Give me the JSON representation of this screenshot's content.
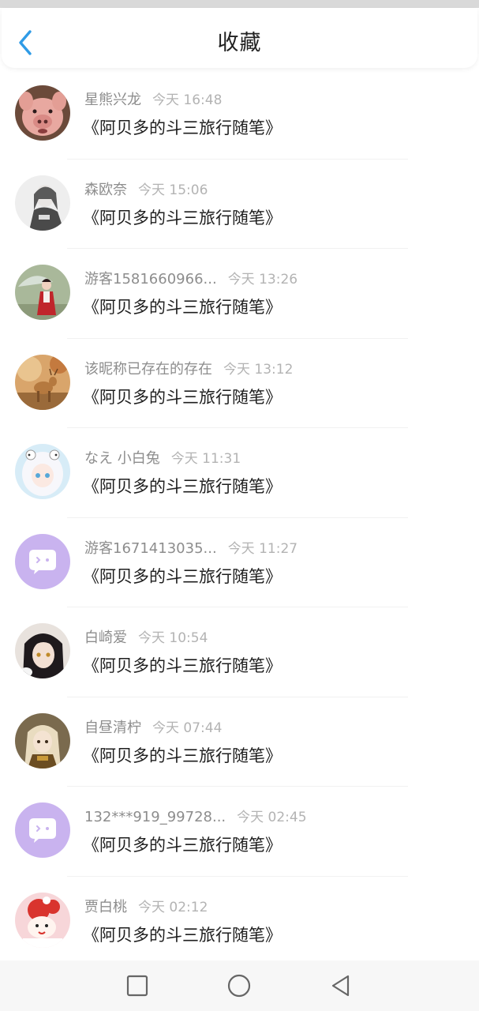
{
  "header": {
    "title": "收藏"
  },
  "items": [
    {
      "name": "星熊兴龙",
      "time": "今天 16:48",
      "book": "《阿贝多的斗三旅行随笔》",
      "avatar_kind": "pig-photo"
    },
    {
      "name": "森欧奈",
      "time": "今天 15:06",
      "book": "《阿贝多的斗三旅行随笔》",
      "avatar_kind": "sketch-girl"
    },
    {
      "name": "游客1581660966...",
      "time": "今天 13:26",
      "book": "《阿贝多的斗三旅行随笔》",
      "avatar_kind": "girl-umbrella"
    },
    {
      "name": "该昵称已存在的存在",
      "time": "今天 13:12",
      "book": "《阿贝多的斗三旅行随笔》",
      "avatar_kind": "deer-autumn"
    },
    {
      "name": "なえ 小白兔",
      "time": "今天 11:31",
      "book": "《阿贝多的斗三旅行随笔》",
      "avatar_kind": "anime-white"
    },
    {
      "name": "游客1671413035...",
      "time": "今天 11:27",
      "book": "《阿贝多的斗三旅行随笔》",
      "avatar_kind": "default-chat"
    },
    {
      "name": "白崎爱",
      "time": "今天 10:54",
      "book": "《阿贝多的斗三旅行随笔》",
      "avatar_kind": "anime-dark"
    },
    {
      "name": "自昼清柠",
      "time": "今天 07:44",
      "book": "《阿贝多的斗三旅行随笔》",
      "avatar_kind": "anime-gold"
    },
    {
      "name": "132***919_99728...",
      "time": "今天 02:45",
      "book": "《阿贝多的斗三旅行随笔》",
      "avatar_kind": "default-chat"
    },
    {
      "name": "贾白桃",
      "time": "今天 02:12",
      "book": "《阿贝多的斗三旅行随笔》",
      "avatar_kind": "cartoon-red"
    }
  ],
  "colors": {
    "accent": "#2f9be6",
    "default_avatar_bg": "#c9b3ef"
  },
  "navbar": {
    "icons": [
      "square-icon",
      "circle-icon",
      "triangle-back-icon"
    ]
  }
}
